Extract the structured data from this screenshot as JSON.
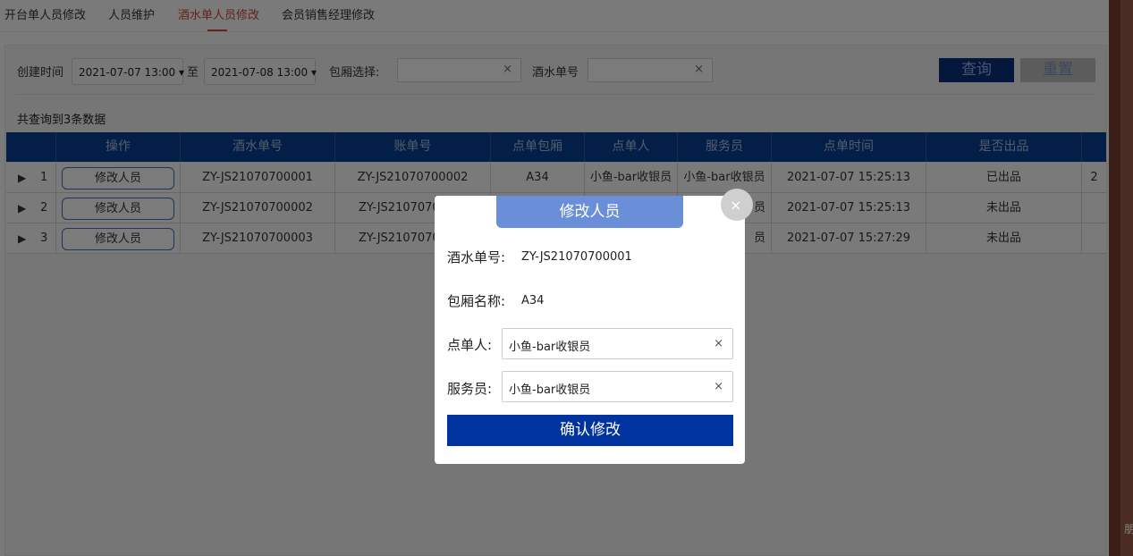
{
  "tabs": [
    {
      "label": "开台单人员修改"
    },
    {
      "label": "人员维护"
    },
    {
      "label": "酒水单人员修改"
    },
    {
      "label": "会员销售经理修改"
    }
  ],
  "active_tab": "酒水单人员修改",
  "filters": {
    "create_time_label": "创建时间",
    "start_date": "2021-07-07 13:00 ▾",
    "to_label": "至",
    "end_date": "2021-07-08 13:00 ▾",
    "room_label": "包厢选择:",
    "room_value": "",
    "order_no_label": "酒水单号",
    "order_no_value": "",
    "clear_icon": "×",
    "query_label": "查询",
    "reset_label": "重置"
  },
  "result_count": "共查询到3条数据",
  "table": {
    "headers": [
      "操作",
      "酒水单号",
      "账单号",
      "点单包厢",
      "点单人",
      "服务员",
      "点单时间",
      "是否出品"
    ],
    "edit_label": "修改人员",
    "rows": [
      {
        "index": "1",
        "order_no": "ZY-JS21070700001",
        "bill_no": "ZY-JS21070700002",
        "room": "A34",
        "orderer": "小鱼-bar收银员",
        "waiter": "小鱼-bar收银员",
        "time": "2021-07-07 15:25:13",
        "status": "已出品",
        "extra": "2"
      },
      {
        "index": "2",
        "order_no": "ZY-JS21070700002",
        "bill_no": "ZY-JS21070700",
        "room": "",
        "orderer": "",
        "waiter": "员",
        "time": "2021-07-07 15:25:13",
        "status": "未出品",
        "extra": ""
      },
      {
        "index": "3",
        "order_no": "ZY-JS21070700003",
        "bill_no": "ZY-JS21070700",
        "room": "",
        "orderer": "",
        "waiter": "员",
        "time": "2021-07-07 15:27:29",
        "status": "未出品",
        "extra": ""
      }
    ]
  },
  "modal": {
    "title": "修改人员",
    "close_icon": "×",
    "order_no_label": "酒水单号:",
    "order_no_value": "ZY-JS21070700001",
    "room_label": "包厢名称:",
    "room_value": "A34",
    "orderer_label": "点单人:",
    "orderer_value": "小鱼-bar收银员",
    "waiter_label": "服务员:",
    "waiter_value": "小鱼-bar收银员",
    "clear_icon": "×",
    "confirm_label": "确认修改"
  },
  "edge_glyph": "朋"
}
